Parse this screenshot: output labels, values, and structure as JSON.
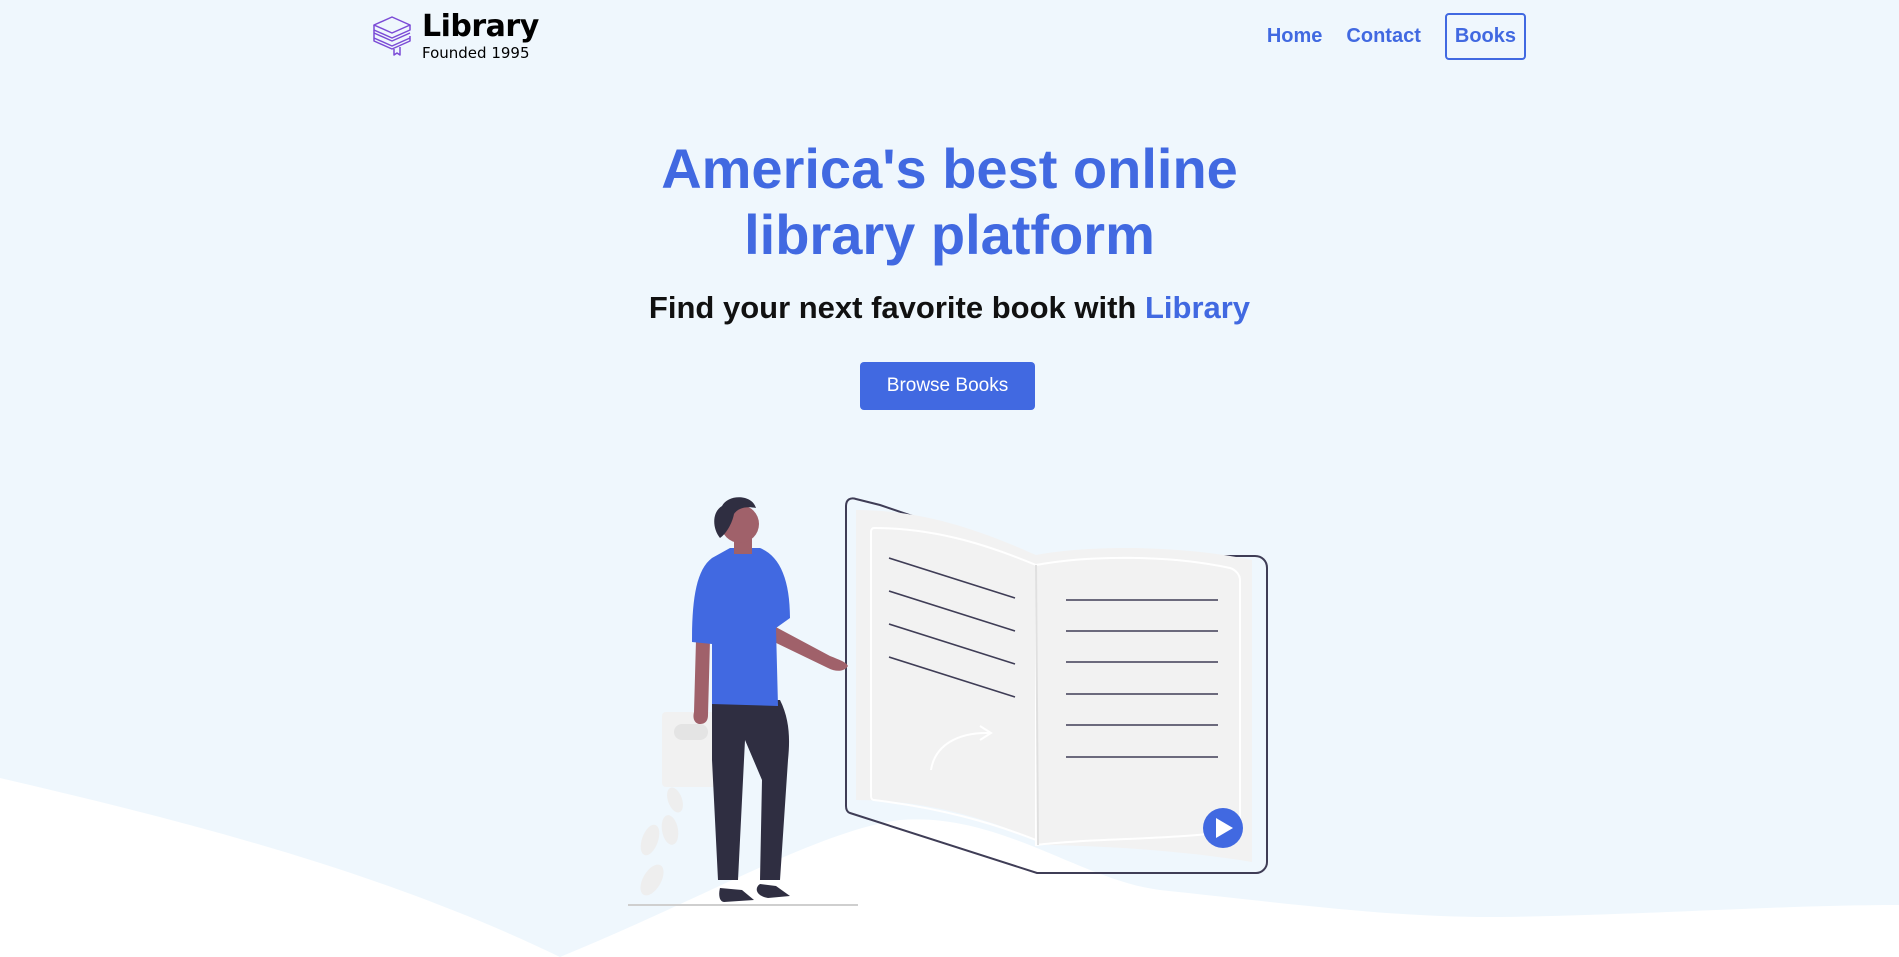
{
  "nav": {
    "logo_title": "Library",
    "logo_subtitle": "Founded 1995",
    "links": [
      "Home",
      "Contact",
      "Books"
    ]
  },
  "hero": {
    "title_line1": "America's best online",
    "title_line2": "library platform",
    "subtitle_prefix": "Find your next favorite book with ",
    "subtitle_accent": "Library",
    "cta_label": "Browse Books"
  },
  "colors": {
    "primary": "#4169e1",
    "background": "#eff7fd",
    "logo_icon": "#7b4bd6"
  },
  "icons": [
    "books-stack-icon",
    "play-icon"
  ]
}
